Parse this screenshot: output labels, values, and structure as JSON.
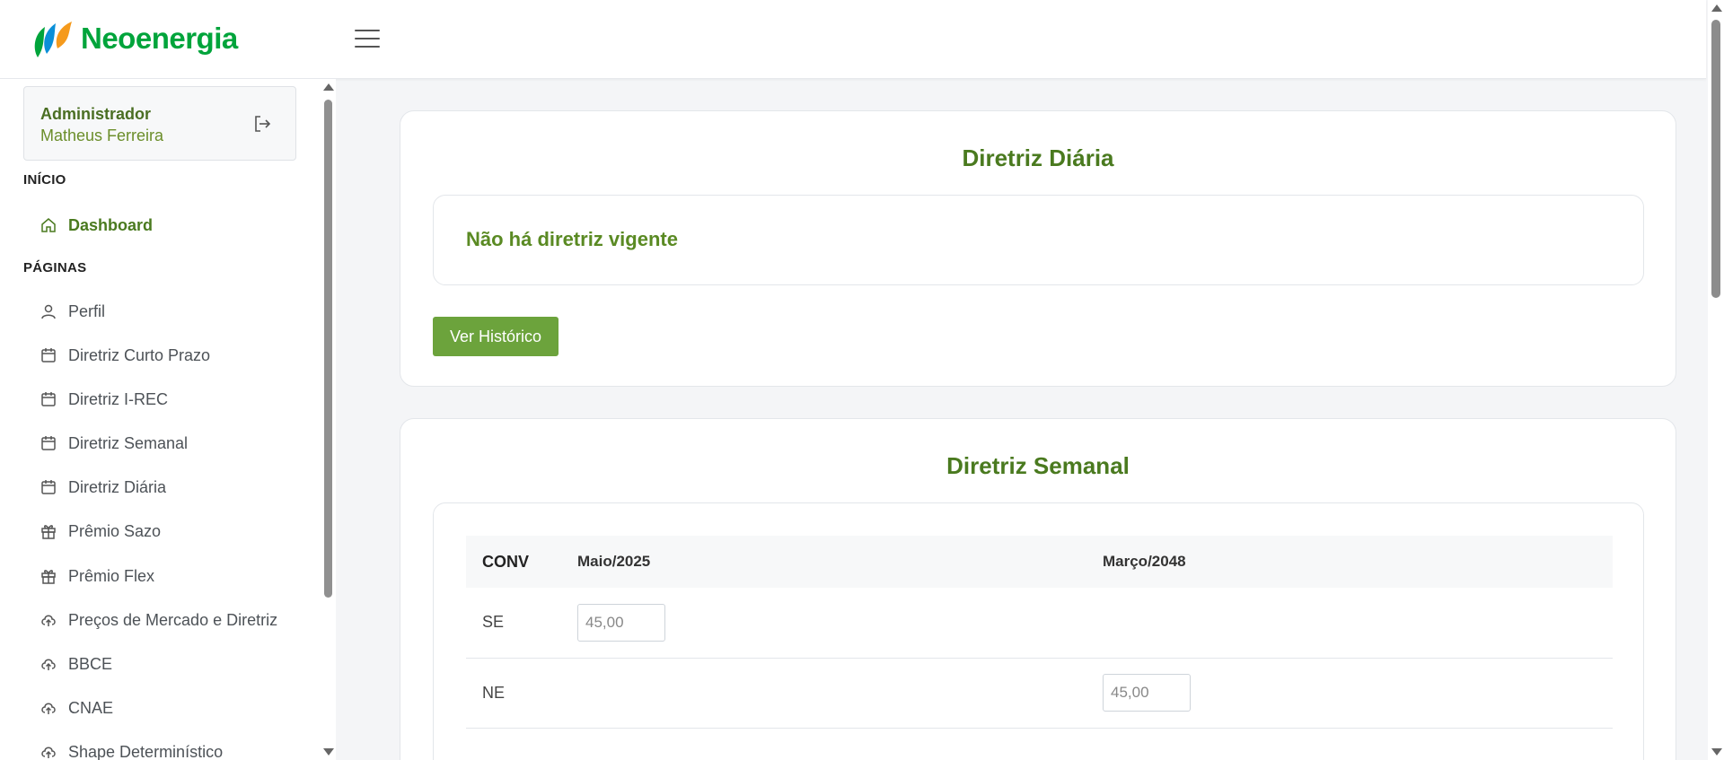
{
  "header": {
    "brand": "Neoenergia"
  },
  "user": {
    "role": "Administrador",
    "name": "Matheus Ferreira"
  },
  "sidebar": {
    "section_start": "INÍCIO",
    "dashboard": "Dashboard",
    "section_pages": "PÁGINAS",
    "items": [
      {
        "label": "Perfil",
        "icon": "user-icon"
      },
      {
        "label": "Diretriz Curto Prazo",
        "icon": "calendar-icon"
      },
      {
        "label": "Diretriz I-REC",
        "icon": "calendar-icon"
      },
      {
        "label": "Diretriz Semanal",
        "icon": "calendar-icon"
      },
      {
        "label": "Diretriz Diária",
        "icon": "calendar-icon"
      },
      {
        "label": "Prêmio Sazo",
        "icon": "gift-icon"
      },
      {
        "label": "Prêmio Flex",
        "icon": "gift-icon"
      },
      {
        "label": "Preços de Mercado e Diretriz",
        "icon": "cloud-upload-icon"
      },
      {
        "label": "BBCE",
        "icon": "cloud-upload-icon"
      },
      {
        "label": "CNAE",
        "icon": "cloud-upload-icon"
      },
      {
        "label": "Shape Determinístico",
        "icon": "cloud-upload-icon"
      }
    ]
  },
  "daily": {
    "title": "Diretriz Diária",
    "empty_message": "Não há diretriz vigente",
    "history_button": "Ver Histórico"
  },
  "weekly": {
    "title": "Diretriz Semanal",
    "columns": [
      "CONV",
      "Maio/2025",
      "Março/2048"
    ],
    "rows": [
      {
        "label": "SE",
        "values": [
          "45,00",
          ""
        ]
      },
      {
        "label": "NE",
        "values": [
          "",
          "45,00"
        ]
      }
    ]
  },
  "colors": {
    "brand_green": "#00a43b",
    "accent_green": "#4a7a1f",
    "button_green": "#6ca33c"
  }
}
